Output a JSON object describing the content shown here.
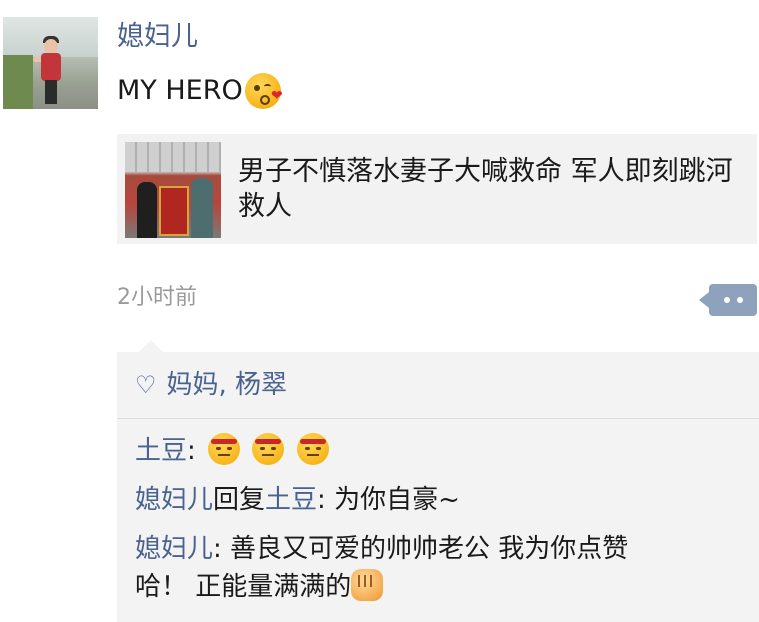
{
  "post": {
    "author": "媳妇儿",
    "text": "MY HERO",
    "emoji": "kiss-emoji",
    "link_title": "男子不慎落水妻子大喊救命 军人即刻跳河救人",
    "time": "2小时前"
  },
  "likes": {
    "names": "妈妈, 杨翠"
  },
  "comments": [
    {
      "nick": "土豆",
      "sep": ": ",
      "emojis": [
        "annoyed-emoji",
        "annoyed-emoji",
        "annoyed-emoji"
      ]
    },
    {
      "nick": "媳妇儿",
      "reply_word": "回复",
      "reply_to": "土豆",
      "sep": ": ",
      "text": "为你自豪~"
    },
    {
      "nick": "媳妇儿",
      "sep": ": ",
      "text_line1": "善良又可爱的帅帅老公 我为你点赞",
      "text_line2": "哈！ 正能量满满的",
      "emoji": "fist-emoji"
    }
  ],
  "colors": {
    "nickname": "#4a628f",
    "comment_bg": "#f3f3f3",
    "link_bg": "#f2f2f2",
    "more_button": "#8ea1bd",
    "time": "#9a9a9a"
  }
}
